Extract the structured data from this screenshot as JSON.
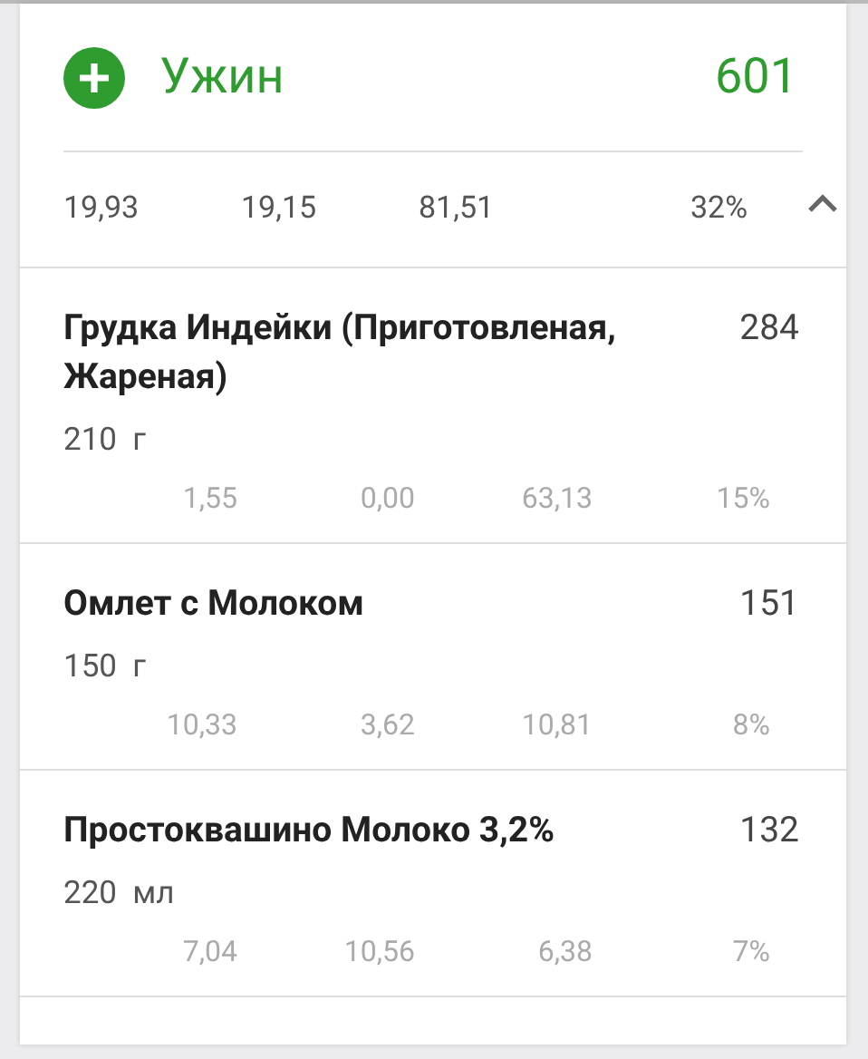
{
  "meal": {
    "title": "Ужин",
    "calories": "601",
    "expanded": true,
    "totals": [
      "19,93",
      "19,15",
      "81,51",
      "32%"
    ]
  },
  "items": [
    {
      "name": "Грудка Индейки (Приготовленая, Жареная)",
      "calories": "284",
      "amount": "210  г",
      "nutrients": [
        "1,55",
        "0,00",
        "63,13",
        "15%"
      ]
    },
    {
      "name": "Омлет с Молоком",
      "calories": "151",
      "amount": "150  г",
      "nutrients": [
        "10,33",
        "3,62",
        "10,81",
        "8%"
      ]
    },
    {
      "name": "Простоквашино Молоко 3,2%",
      "calories": "132",
      "amount": "220  мл",
      "nutrients": [
        "7,04",
        "10,56",
        "6,38",
        "7%"
      ]
    }
  ]
}
